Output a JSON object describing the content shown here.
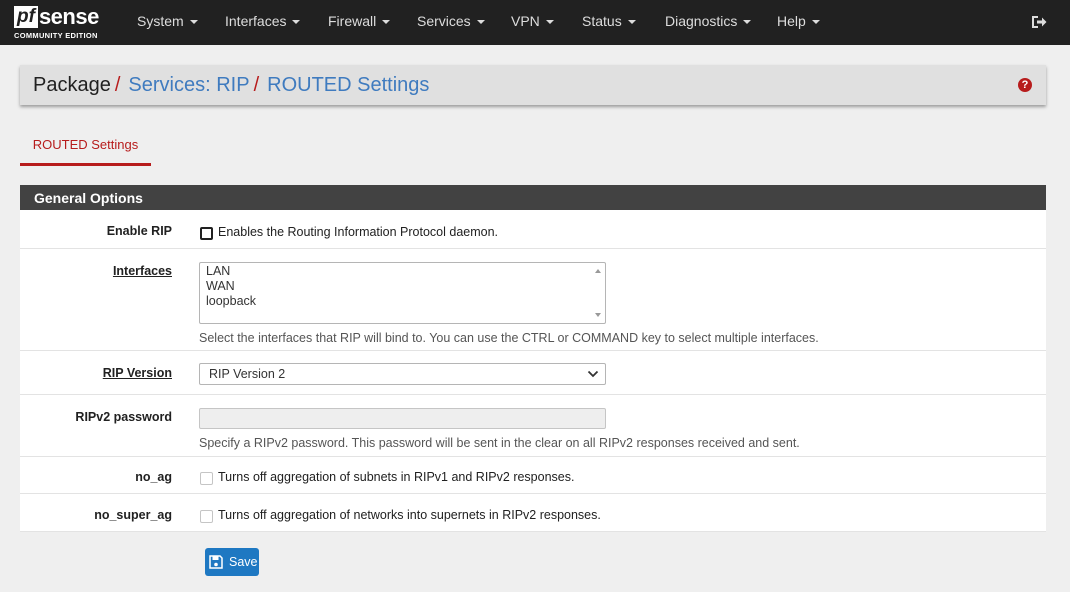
{
  "logo": {
    "word_pf": "pf",
    "word_sense": "sense",
    "edition": "COMMUNITY EDITION"
  },
  "nav": [
    "System",
    "Interfaces",
    "Firewall",
    "Services",
    "VPN",
    "Status",
    "Diagnostics",
    "Help"
  ],
  "breadcrumb": {
    "root": "Package",
    "section": "Services: RIP",
    "page": "ROUTED Settings",
    "separator": "/"
  },
  "tab": {
    "label": "ROUTED Settings"
  },
  "panel": {
    "title": "General Options",
    "enable": {
      "label": "Enable RIP",
      "text": "Enables the Routing Information Protocol daemon.",
      "checked": false
    },
    "interfaces": {
      "label": "Interfaces",
      "options": [
        "LAN",
        "WAN",
        "loopback"
      ],
      "help": "Select the interfaces that RIP will bind to. You can use the CTRL or COMMAND key to select multiple interfaces."
    },
    "rip_version": {
      "label": "RIP Version",
      "value": "RIP Version 2"
    },
    "password": {
      "label": "RIPv2 password",
      "value": "",
      "help": "Specify a RIPv2 password. This password will be sent in the clear on all RIPv2 responses received and sent."
    },
    "no_ag": {
      "label": "no_ag",
      "text": "Turns off aggregation of subnets in RIPv1 and RIPv2 responses.",
      "checked": false
    },
    "no_super_ag": {
      "label": "no_super_ag",
      "text": "Turns off aggregation of networks into supernets in RIPv2 responses.",
      "checked": false
    }
  },
  "save_label": "Save",
  "colors": {
    "navbar": "#212121",
    "accent_red": "#b71c1c",
    "link_blue": "#3f7bbf",
    "button_blue": "#1e78c2",
    "panel_head": "#424242"
  },
  "icons": {
    "logout": "sign-out-icon",
    "help": "question-circle-icon",
    "save": "floppy-disk-icon"
  }
}
